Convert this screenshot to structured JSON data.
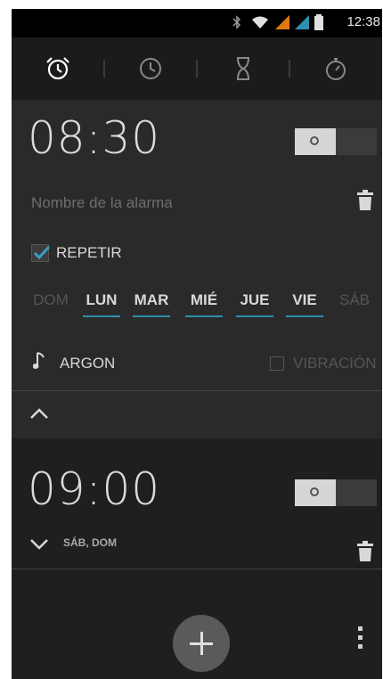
{
  "status_bar": {
    "time": "12:38",
    "icons": [
      "bluetooth-icon",
      "wifi-icon",
      "signal-icon",
      "signal-icon",
      "battery-icon"
    ]
  },
  "tabs": [
    {
      "name": "alarm",
      "icon": "alarm-clock-icon",
      "selected": true
    },
    {
      "name": "clock",
      "icon": "clock-icon",
      "selected": false
    },
    {
      "name": "timer",
      "icon": "hourglass-icon",
      "selected": false
    },
    {
      "name": "stopwatch",
      "icon": "stopwatch-icon",
      "selected": false
    }
  ],
  "alarms": [
    {
      "time": "08:30",
      "enabled": false,
      "name_placeholder": "Nombre de la alarma",
      "repeat_label": "REPETIR",
      "repeat_checked": true,
      "days": [
        {
          "label": "DOM",
          "active": false
        },
        {
          "label": "LUN",
          "active": true
        },
        {
          "label": "MAR",
          "active": true
        },
        {
          "label": "MIÉ",
          "active": true
        },
        {
          "label": "JUE",
          "active": true
        },
        {
          "label": "VIE",
          "active": true
        },
        {
          "label": "SÁB",
          "active": false
        }
      ],
      "ringtone": "ARGON",
      "vibration_label": "VIBRACIÓN",
      "vibration_checked": false,
      "expanded": true
    },
    {
      "time": "09:00",
      "enabled": false,
      "days_summary": "SÁB, DOM",
      "expanded": false
    }
  ],
  "colors": {
    "accent": "#2f8fb0",
    "background": "#1f1f1f",
    "card_expanded": "#2a2a2a"
  }
}
